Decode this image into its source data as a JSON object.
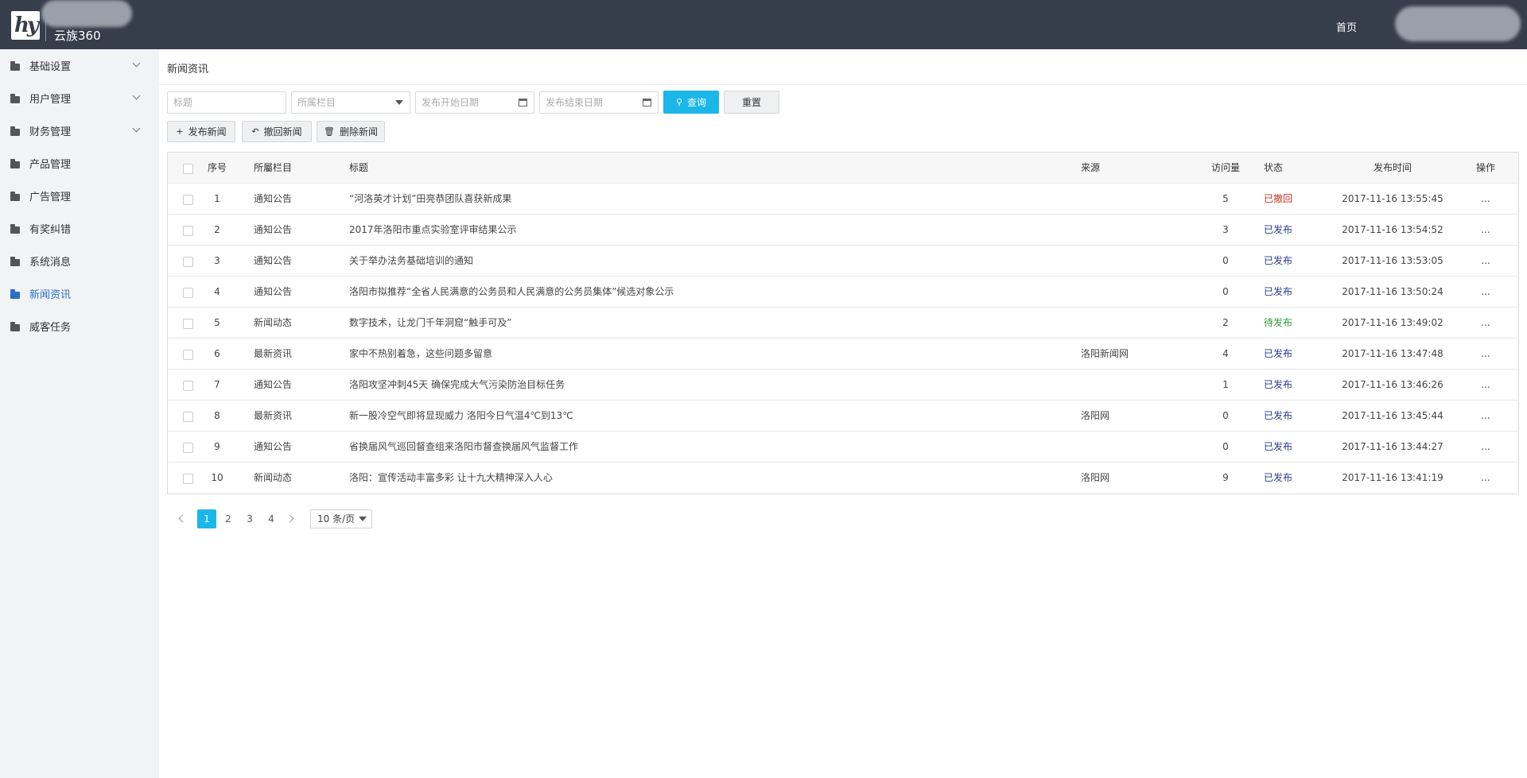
{
  "header": {
    "logo_text": "hy",
    "brand": "云族360",
    "home": "首页"
  },
  "sidebar": {
    "items": [
      {
        "label": "基础设置",
        "has_arrow": true
      },
      {
        "label": "用户管理",
        "has_arrow": true
      },
      {
        "label": "财务管理",
        "has_arrow": true
      },
      {
        "label": "产品管理",
        "has_arrow": false
      },
      {
        "label": "广告管理",
        "has_arrow": false
      },
      {
        "label": "有奖纠错",
        "has_arrow": false
      },
      {
        "label": "系统消息",
        "has_arrow": false
      },
      {
        "label": "新闻资讯",
        "has_arrow": false,
        "active": true
      },
      {
        "label": "威客任务",
        "has_arrow": false
      }
    ]
  },
  "main": {
    "page_title": "新闻资讯",
    "filters": {
      "title_placeholder": "标题",
      "category_placeholder": "所属栏目",
      "start_date_placeholder": "发布开始日期",
      "end_date_placeholder": "发布结束日期",
      "search_label": "查询",
      "reset_label": "重置"
    },
    "actions": {
      "publish": "发布新闻",
      "withdraw": "撤回新闻",
      "delete": "删除新闻"
    },
    "table": {
      "headers": {
        "index": "序号",
        "category": "所屬栏目",
        "title": "标题",
        "source": "来源",
        "views": "访问量",
        "status": "状态",
        "time": "发布时间",
        "op": "操作"
      },
      "rows": [
        {
          "index": "1",
          "category": "通知公告",
          "title": "“河洛英才计划”田亮恭团队喜获新成果",
          "source": "",
          "views": "5",
          "status": "已撤回",
          "time": "2017-11-16 13:55:45",
          "op": "..."
        },
        {
          "index": "2",
          "category": "通知公告",
          "title": "2017年洛阳市重点实验室评审结果公示",
          "source": "",
          "views": "3",
          "status": "已发布",
          "time": "2017-11-16 13:54:52",
          "op": "..."
        },
        {
          "index": "3",
          "category": "通知公告",
          "title": "关于举办法务基础培训的通知",
          "source": "",
          "views": "0",
          "status": "已发布",
          "time": "2017-11-16 13:53:05",
          "op": "..."
        },
        {
          "index": "4",
          "category": "通知公告",
          "title": "洛阳市拟推荐“全省人民满意的公务员和人民满意的公务员集体”候选对象公示",
          "source": "",
          "views": "0",
          "status": "已发布",
          "time": "2017-11-16 13:50:24",
          "op": "..."
        },
        {
          "index": "5",
          "category": "新闻动态",
          "title": "数字技术，让龙门千年洞窟“触手可及”",
          "source": "",
          "views": "2",
          "status": "待发布",
          "time": "2017-11-16 13:49:02",
          "op": "..."
        },
        {
          "index": "6",
          "category": "最新资讯",
          "title": "家中不热别着急，这些问题多留意",
          "source": "洛阳新闻网",
          "views": "4",
          "status": "已发布",
          "time": "2017-11-16 13:47:48",
          "op": "..."
        },
        {
          "index": "7",
          "category": "通知公告",
          "title": "洛阳攻坚冲刺45天 确保完成大气污染防治目标任务",
          "source": "",
          "views": "1",
          "status": "已发布",
          "time": "2017-11-16 13:46:26",
          "op": "..."
        },
        {
          "index": "8",
          "category": "最新资讯",
          "title": "新一股冷空气即将显现威力 洛阳今日气温4℃到13℃",
          "source": "洛阳网",
          "views": "0",
          "status": "已发布",
          "time": "2017-11-16 13:45:44",
          "op": "..."
        },
        {
          "index": "9",
          "category": "通知公告",
          "title": "省换届风气巡回督查组来洛阳市督查换届风气监督工作",
          "source": "",
          "views": "0",
          "status": "已发布",
          "time": "2017-11-16 13:44:27",
          "op": "..."
        },
        {
          "index": "10",
          "category": "新闻动态",
          "title": "洛阳：宣传活动丰富多彩 让十九大精神深入人心",
          "source": "洛阳网",
          "views": "9",
          "status": "已发布",
          "time": "2017-11-16 13:41:19",
          "op": "..."
        }
      ]
    },
    "pagination": {
      "pages": [
        "1",
        "2",
        "3",
        "4"
      ],
      "current": "1",
      "page_size": "10 条/页"
    }
  },
  "colors": {
    "header_bg": "#363e4b",
    "accent": "#1ab7e8",
    "active_nav": "#2a6fc9",
    "status_published": "#2b3a8c",
    "status_withdrawn": "#c0392b",
    "status_pending": "#2e9a3a"
  },
  "icons": {
    "search": "search-icon",
    "add": "plus-icon",
    "undo": "undo-icon",
    "delete": "trash-icon",
    "calendar": "calendar-icon",
    "folder": "folder-icon"
  }
}
